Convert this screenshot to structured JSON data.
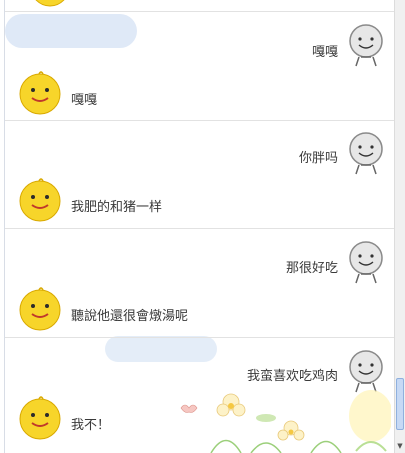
{
  "chat": {
    "messages": [
      {
        "id": "m1",
        "sender": "other",
        "avatar": "gray-face-icon",
        "text": "嘎嘎"
      },
      {
        "id": "m2",
        "sender": "me",
        "avatar": "yellow-chick-icon",
        "text": "嘎嘎"
      },
      {
        "id": "m3",
        "sender": "other",
        "avatar": "gray-face-icon",
        "text": "你胖吗"
      },
      {
        "id": "m4",
        "sender": "me",
        "avatar": "yellow-chick-icon",
        "text": "我肥的和猪一样"
      },
      {
        "id": "m5",
        "sender": "other",
        "avatar": "gray-face-icon",
        "text": "那很好吃"
      },
      {
        "id": "m6",
        "sender": "me",
        "avatar": "yellow-chick-icon",
        "text": "聽說他還很會燉湯呢"
      },
      {
        "id": "m7",
        "sender": "other",
        "avatar": "gray-face-icon",
        "text": "我蛮喜欢吃鸡肉"
      },
      {
        "id": "m8",
        "sender": "me",
        "avatar": "yellow-chick-icon",
        "text": "我不！"
      }
    ]
  },
  "colors": {
    "chick_yellow": "#f7d52a",
    "gray_face": "#e4e4e4",
    "cloud": "#dbe7f6",
    "scroll_thumb": "#c6d9f5"
  }
}
